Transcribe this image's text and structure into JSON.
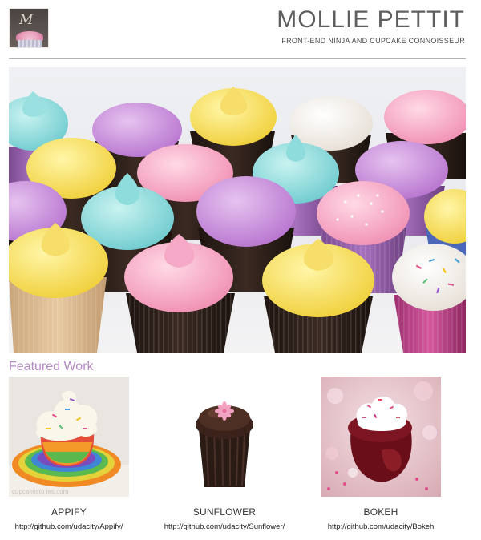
{
  "header": {
    "title": "MOLLIE PETTIT",
    "subtitle": "FRONT-END NINJA AND CUPCAKE CONNOISSEUR",
    "logo_monogram": "M",
    "logo_icon": "cupcake-logo-icon"
  },
  "hero": {
    "image_icon": "cupcakes-hero-image"
  },
  "featured": {
    "heading": "Featured Work",
    "items": [
      {
        "name": "APPIFY",
        "link": "http://github.com/udacity/Appify/",
        "image_icon": "rainbow-cupcake-image"
      },
      {
        "name": "SUNFLOWER",
        "link": "http://github.com/udacity/Sunflower/",
        "image_icon": "chocolate-cupcake-image"
      },
      {
        "name": "BOKEH",
        "link": "http://github.com/udacity/Bokeh",
        "image_icon": "red-velvet-cupcake-image"
      }
    ],
    "watermark": "cupcakesto ies.com"
  },
  "colors": {
    "title": "#5e5e5e",
    "heading": "#b38cc4",
    "divider": "#b3b3b3"
  }
}
